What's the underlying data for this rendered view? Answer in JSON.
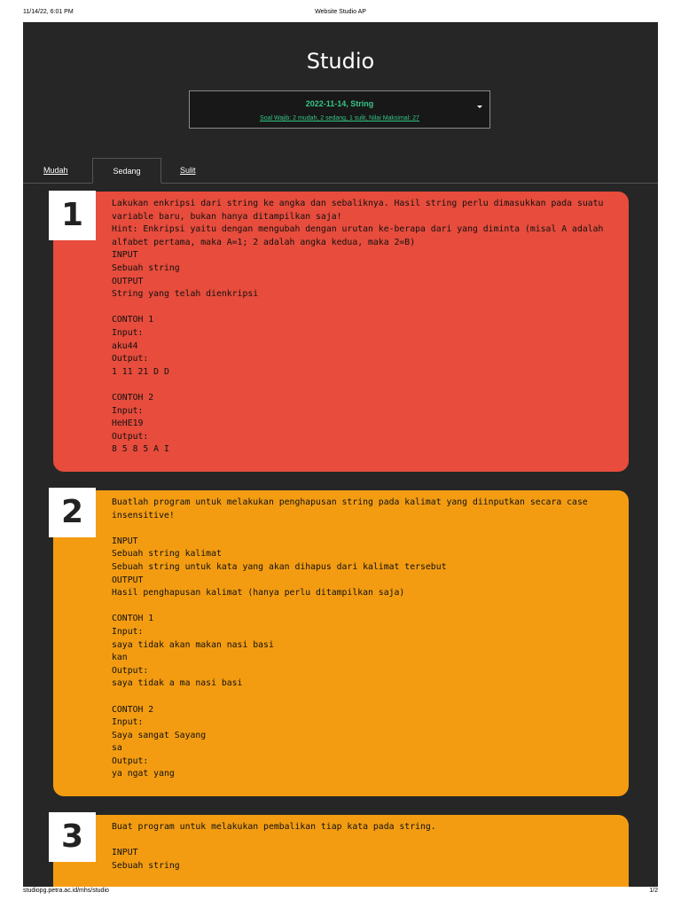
{
  "print": {
    "datetime": "11/14/22, 6:01 PM",
    "page_title": "Website Studio AP",
    "url": "studiopg.petra.ac.id/mhs/studio",
    "page_num": "1/2"
  },
  "app": {
    "title": "Studio",
    "selector": {
      "title": "2022-11-14, String",
      "subtitle": "Soal Wajib: 2 mudah, 2 sedang, 1 sulit, Nilai Maksimal: 27"
    },
    "colors": {
      "background": "#262626",
      "accent": "#35c586",
      "red": "#e74c3c",
      "orange": "#f39c12"
    }
  },
  "tabs": [
    {
      "label": "Mudah"
    },
    {
      "label": "Sedang"
    },
    {
      "label": "Sulit"
    }
  ],
  "questions": [
    {
      "number": "1",
      "text": "Lakukan enkripsi dari string ke angka dan sebaliknya. Hasil string perlu dimasukkan pada suatu variable baru, bukan hanya ditampilkan saja!\nHint: Enkripsi yaitu dengan mengubah dengan urutan ke-berapa dari yang diminta (misal A adalah alfabet pertama, maka A=1; 2 adalah angka kedua, maka 2=B)\nINPUT\nSebuah string\nOUTPUT\nString yang telah dienkripsi\n\nCONTOH 1\nInput:\naku44\nOutput:\n1 11 21 D D\n\nCONTOH 2\nInput:\nHeHE19\nOutput:\n8 5 8 5 A I"
    },
    {
      "number": "2",
      "text": "Buatlah program untuk melakukan penghapusan string pada kalimat yang diinputkan secara case insensitive!\n\nINPUT\nSebuah string kalimat\nSebuah string untuk kata yang akan dihapus dari kalimat tersebut\nOUTPUT\nHasil penghapusan kalimat (hanya perlu ditampilkan saja)\n\nCONTOH 1\nInput:\nsaya tidak akan makan nasi basi\nkan\nOutput:\nsaya tidak a ma nasi basi\n\nCONTOH 2\nInput:\nSaya sangat Sayang\nsa\nOutput:\nya ngat yang"
    },
    {
      "number": "3",
      "text": "Buat program untuk melakukan pembalikan tiap kata pada string.\n\nINPUT\nSebuah string"
    }
  ]
}
